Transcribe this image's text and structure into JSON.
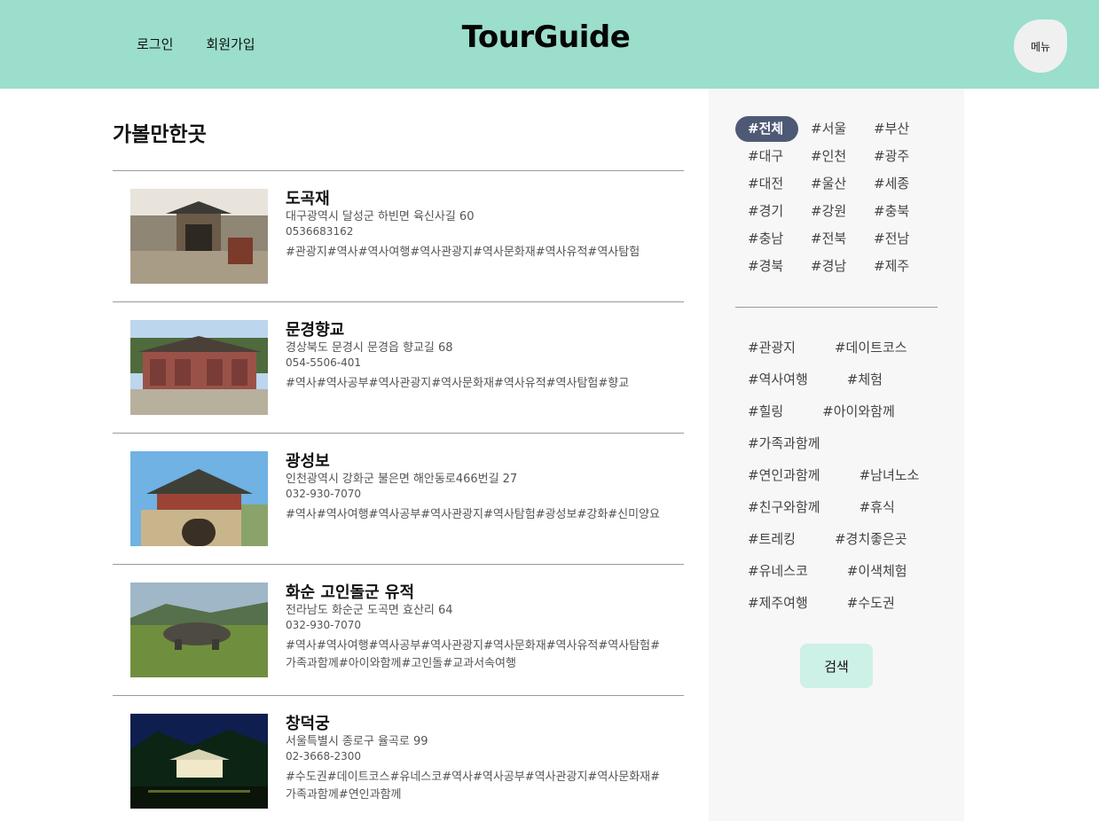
{
  "header": {
    "login": "로그인",
    "signup": "회원가입",
    "logo": "TourGuide",
    "menu": "메뉴"
  },
  "main": {
    "title": "가볼만한곳",
    "items": [
      {
        "name": "도곡재",
        "address": "대구광역시 달성군 하빈면 육신사길 60",
        "phone": "0536683162",
        "tags": "#관광지#역사#역사여행#역사관광지#역사문화재#역사유적#역사탐험"
      },
      {
        "name": "문경향교",
        "address": "경상북도 문경시 문경읍 향교길 68",
        "phone": "054-5506-401",
        "tags": "#역사#역사공부#역사관광지#역사문화재#역사유적#역사탐험#향교"
      },
      {
        "name": "광성보",
        "address": "인천광역시 강화군 불은면 해안동로466번길 27",
        "phone": "032-930-7070",
        "tags": "#역사#역사여행#역사공부#역사관광지#역사탐험#광성보#강화#신미양요"
      },
      {
        "name": "화순 고인돌군 유적",
        "address": "전라남도 화순군 도곡면 효산리 64",
        "phone": "032-930-7070",
        "tags": "#역사#역사여행#역사공부#역사관광지#역사문화재#역사유적#역사탐험#가족과함께#아이와함께#고인돌#교과서속여행"
      },
      {
        "name": "창덕궁",
        "address": "서울특별시 종로구 율곡로 99",
        "phone": "02-3668-2300",
        "tags": "#수도권#데이트코스#유네스코#역사#역사공부#역사관광지#역사문화재#가족과함께#연인과함께"
      }
    ]
  },
  "sidebar": {
    "regions": [
      "#전체",
      "#서울",
      "#부산",
      "#대구",
      "#인천",
      "#광주",
      "#대전",
      "#울산",
      "#세종",
      "#경기",
      "#강원",
      "#충북",
      "#충남",
      "#전북",
      "#전남",
      "#경북",
      "#경남",
      "#제주"
    ],
    "themes": [
      [
        "#관광지",
        "#데이트코스"
      ],
      [
        "#역사여행",
        "#체험"
      ],
      [
        "#힐링",
        "#아이와함께"
      ],
      [
        "#가족과함께"
      ],
      [
        "#연인과함께",
        "#남녀노소"
      ],
      [
        "#친구와함께",
        "#휴식"
      ],
      [
        "#트레킹",
        "#경치좋은곳"
      ],
      [
        "#유네스코",
        "#이색체험"
      ],
      [
        "#제주여행",
        "#수도권"
      ]
    ],
    "search": "검색"
  },
  "colors": {
    "header_bg": "#9adecb",
    "active_chip": "#4e5a75",
    "search_bg": "#cdf0e7",
    "sidebar_bg": "#f7f7f7"
  }
}
